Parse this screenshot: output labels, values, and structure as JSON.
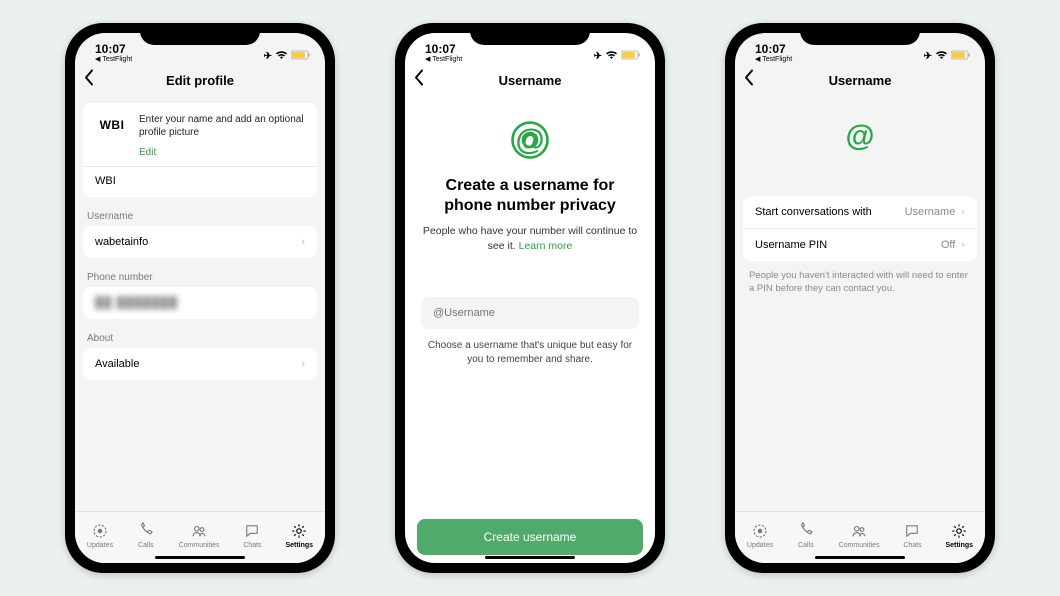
{
  "status": {
    "time": "10:07",
    "subtitle": "TestFlight"
  },
  "tabs": {
    "updates": "Updates",
    "calls": "Calls",
    "communities": "Communities",
    "chats": "Chats",
    "settings": "Settings"
  },
  "screen1": {
    "title": "Edit profile",
    "avatar_text": "WBI",
    "profile_hint": "Enter your name and add an optional profile picture",
    "edit": "Edit",
    "name": "WBI",
    "username_label": "Username",
    "username_value": "wabetainfo",
    "phone_label": "Phone number",
    "phone_value": "██ ███████",
    "about_label": "About",
    "about_value": "Available"
  },
  "screen2": {
    "title": "Username",
    "heading": "Create a username for phone number privacy",
    "sub": "People who have your number will continue to see it. ",
    "learn": "Learn more",
    "placeholder": "@Username",
    "hint": "Choose a username that's unique but easy for you to remember and share.",
    "cta": "Create username"
  },
  "screen3": {
    "title": "Username",
    "row1_label": "Start conversations with",
    "row1_value": "Username",
    "row2_label": "Username PIN",
    "row2_value": "Off",
    "note": "People you haven't interacted with will need to enter a PIN before they can contact you."
  }
}
